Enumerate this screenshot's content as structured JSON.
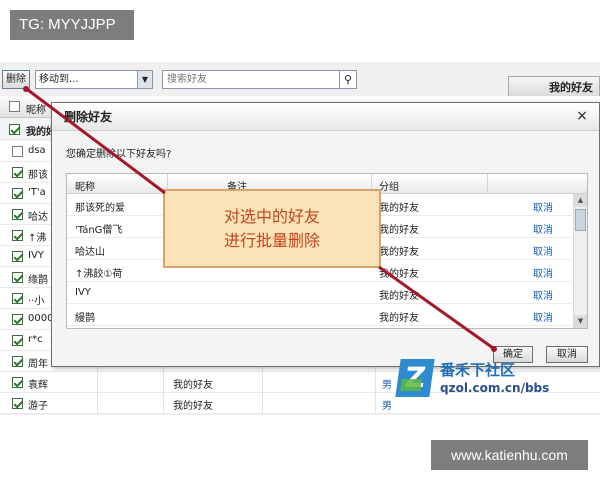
{
  "watermark_top": "TG: MYYJJPP",
  "watermark_bottom": "www.katienhu.com",
  "toolbar": {
    "delete_label": "删除",
    "move_label": "移动到...",
    "search_placeholder": "搜索好友",
    "group_tab": "我的好友"
  },
  "list": {
    "header_label": "昵称",
    "group_label": "我的好友",
    "rows": [
      {
        "name": "dsa",
        "checked": false
      },
      {
        "name": "那该",
        "checked": true
      },
      {
        "name": "'T'a",
        "checked": true
      },
      {
        "name": "哈达",
        "checked": true
      },
      {
        "name": "↑沸",
        "checked": true
      },
      {
        "name": "IVY",
        "checked": true
      },
      {
        "name": "缘鹊",
        "checked": true
      },
      {
        "name": "··小",
        "checked": true
      },
      {
        "name": "0000",
        "checked": true
      },
      {
        "name": "r*c",
        "checked": true
      },
      {
        "name": "周年",
        "checked": true
      },
      {
        "name": "袁辉",
        "checked": true,
        "group": "我的好友",
        "gender": "男"
      },
      {
        "name": "游子",
        "checked": true,
        "group": "我的好友",
        "gender": "男"
      }
    ]
  },
  "dialog": {
    "title": "删除好友",
    "close_glyph": "×",
    "prompt": "您确定删除以下好友吗?",
    "columns": {
      "name": "昵称",
      "remark": "备注",
      "group": "分组"
    },
    "rows": [
      {
        "name": "那该死的爱",
        "remark": "",
        "group": "我的好友",
        "action": "取消"
      },
      {
        "name": "'TánG僧飞",
        "remark": "",
        "group": "我的好友",
        "action": "取消"
      },
      {
        "name": "哈达山",
        "remark": "",
        "group": "我的好友",
        "action": "取消"
      },
      {
        "name": "↑沸餃①荷",
        "remark": "",
        "group": "我的好友",
        "action": "取消"
      },
      {
        "name": "IVY",
        "remark": "",
        "group": "我的好友",
        "action": "取消"
      },
      {
        "name": "縵鹊",
        "remark": "",
        "group": "我的好友",
        "action": "取消"
      }
    ],
    "ok_label": "确定",
    "cancel_label": "取消"
  },
  "callout": {
    "line1": "对选中的好友",
    "line2": "进行批量删除"
  },
  "logo": {
    "cn": "番禾下社区",
    "en": "qzol.com.cn/bbs"
  },
  "colors": {
    "arrow": "#a3182a",
    "callout_text": "#c4441c"
  }
}
